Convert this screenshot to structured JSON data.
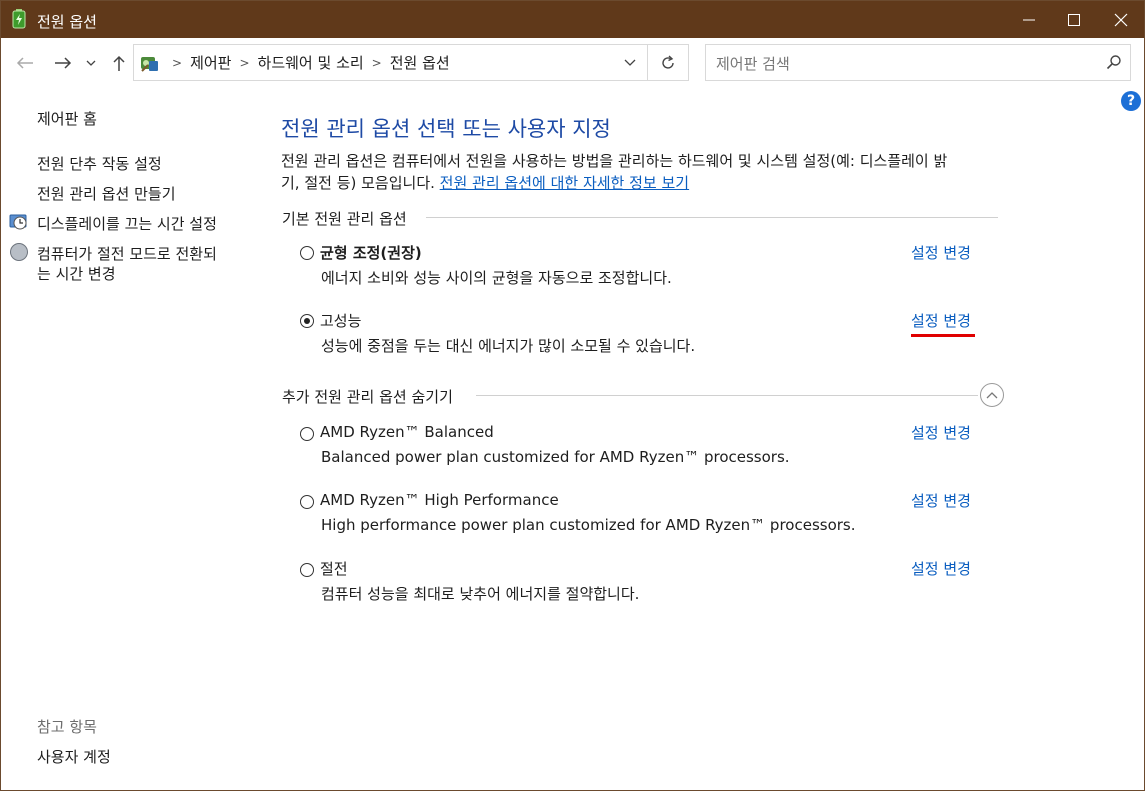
{
  "window": {
    "title": "전원 옵션",
    "minimize_icon": "minimize-icon",
    "maximize_icon": "maximize-icon",
    "close_icon": "close-icon"
  },
  "nav": {
    "breadcrumbs": [
      "제어판",
      "하드웨어 및 소리",
      "전원 옵션"
    ],
    "search_placeholder": "제어판 검색"
  },
  "help_label": "?",
  "sidebar": {
    "home": "제어판 홈",
    "links": [
      {
        "label": "전원 단추 작동 설정"
      },
      {
        "label": "전원 관리 옵션 만들기"
      },
      {
        "label": "디스플레이를 끄는 시간 설정",
        "icon": "display-clock-icon"
      },
      {
        "label_line1": "컴퓨터가 절전 모드로 전환되",
        "label_line2": "는 시간 변경",
        "icon": "moon-icon"
      }
    ],
    "see_also_heading": "참고 항목",
    "see_also_links": [
      "사용자 계정"
    ]
  },
  "main": {
    "heading": "전원 관리 옵션 선택 또는 사용자 지정",
    "description_line1": "전원 관리 옵션은 컴퓨터에서 전원을 사용하는 방법을 관리하는 하드웨어 및 시스템 설정(예: 디스플레이 밝",
    "description_line2_prefix": "기, 절전 등) 모음입니다. ",
    "description_link": "전원 관리 옵션에 대한 자세한 정보 보기",
    "preferred_section": "기본 전원 관리 옵션",
    "additional_section": "추가 전원 관리 옵션 숨기기",
    "change_label": "설정 변경",
    "preferred_plans": [
      {
        "name": "균형 조정(권장)",
        "desc": "에너지 소비와 성능 사이의 균형을 자동으로 조정합니다.",
        "selected": false
      },
      {
        "name": "고성능",
        "desc": "성능에 중점을 두는 대신 에너지가 많이 소모될 수 있습니다.",
        "selected": true
      }
    ],
    "additional_plans": [
      {
        "name": "AMD Ryzen™ Balanced",
        "desc": "Balanced power plan customized for AMD Ryzen™ processors.",
        "selected": false
      },
      {
        "name": "AMD Ryzen™ High Performance",
        "desc": "High performance power plan customized for AMD Ryzen™ processors.",
        "selected": false
      },
      {
        "name": "절전",
        "desc": "컴퓨터 성능을 최대로 낮추어 에너지를 절약합니다.",
        "selected": false
      }
    ]
  },
  "colors": {
    "titlebar": "#60391a",
    "link": "#0b5ec0",
    "heading": "#1e4aa5",
    "highlight": "#e00000"
  }
}
